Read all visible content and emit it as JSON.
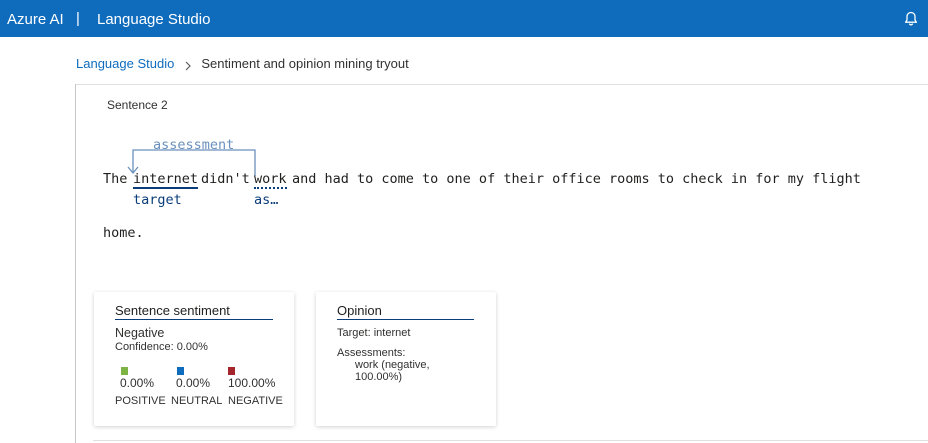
{
  "topbar": {
    "brand": "Azure AI",
    "separator": "|",
    "product": "Language Studio",
    "notification_icon": "bell-icon"
  },
  "breadcrumb": {
    "root": "Language Studio",
    "current": "Sentiment and opinion mining tryout",
    "chevron_icon": "chevron-right-icon"
  },
  "sentence": {
    "label": "Sentence 2",
    "words": {
      "the": "The",
      "internet": "internet",
      "didnt": "didn't",
      "work": "work",
      "rest": "and had to come to one of their office rooms to check in for my flight"
    },
    "line2": "home.",
    "relation_label": "assessment",
    "target_tag": "target",
    "assessment_tag": "as…"
  },
  "sentiment_card": {
    "title": "Sentence sentiment",
    "overall": "Negative",
    "confidence": "Confidence: 0.00%",
    "scores": [
      {
        "label": "POSITIVE",
        "value": "0.00%",
        "color": "#7cb342"
      },
      {
        "label": "NEUTRAL",
        "value": "0.00%",
        "color": "#0f6cbd"
      },
      {
        "label": "NEGATIVE",
        "value": "100.00%",
        "color": "#a4262c"
      }
    ]
  },
  "opinion_card": {
    "title": "Opinion",
    "target_label": "Target:",
    "target_value": "internet",
    "assessments_label": "Assessments:",
    "assessment_line1": "work (negative,",
    "assessment_line2": "100.00%)"
  },
  "colors": {
    "header_blue": "#0f6cbd",
    "annotation_dark": "#0a3d7a",
    "relation_light": "#6a90bd"
  }
}
